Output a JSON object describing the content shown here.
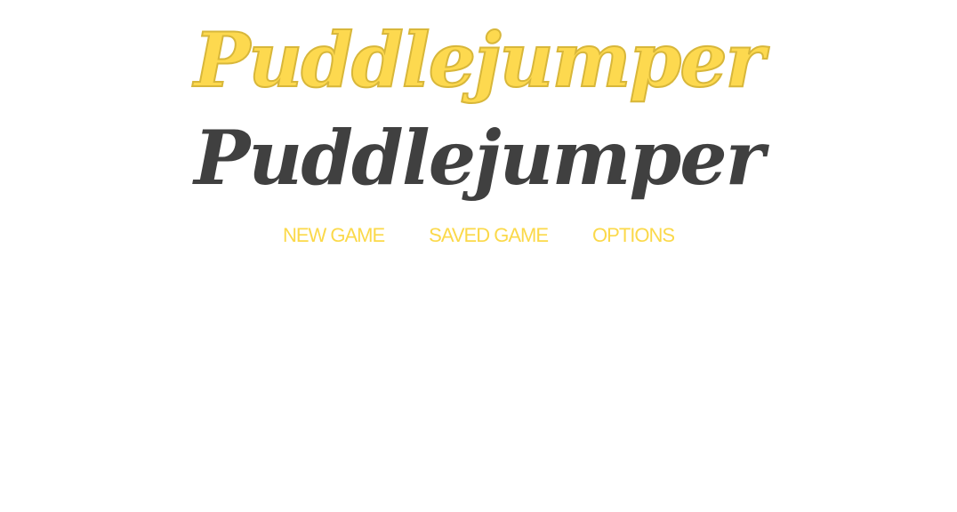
{
  "title": {
    "logo_text_primary": "Puddlejumper",
    "logo_text_secondary": "Puddlejumper"
  },
  "menu": {
    "items": [
      {
        "label": "NEW GAME"
      },
      {
        "label": "SAVED GAME"
      },
      {
        "label": "OPTIONS"
      }
    ]
  },
  "colors": {
    "accent_yellow": "#fdd94f",
    "logo_dark": "#404040",
    "background": "#ffffff"
  }
}
